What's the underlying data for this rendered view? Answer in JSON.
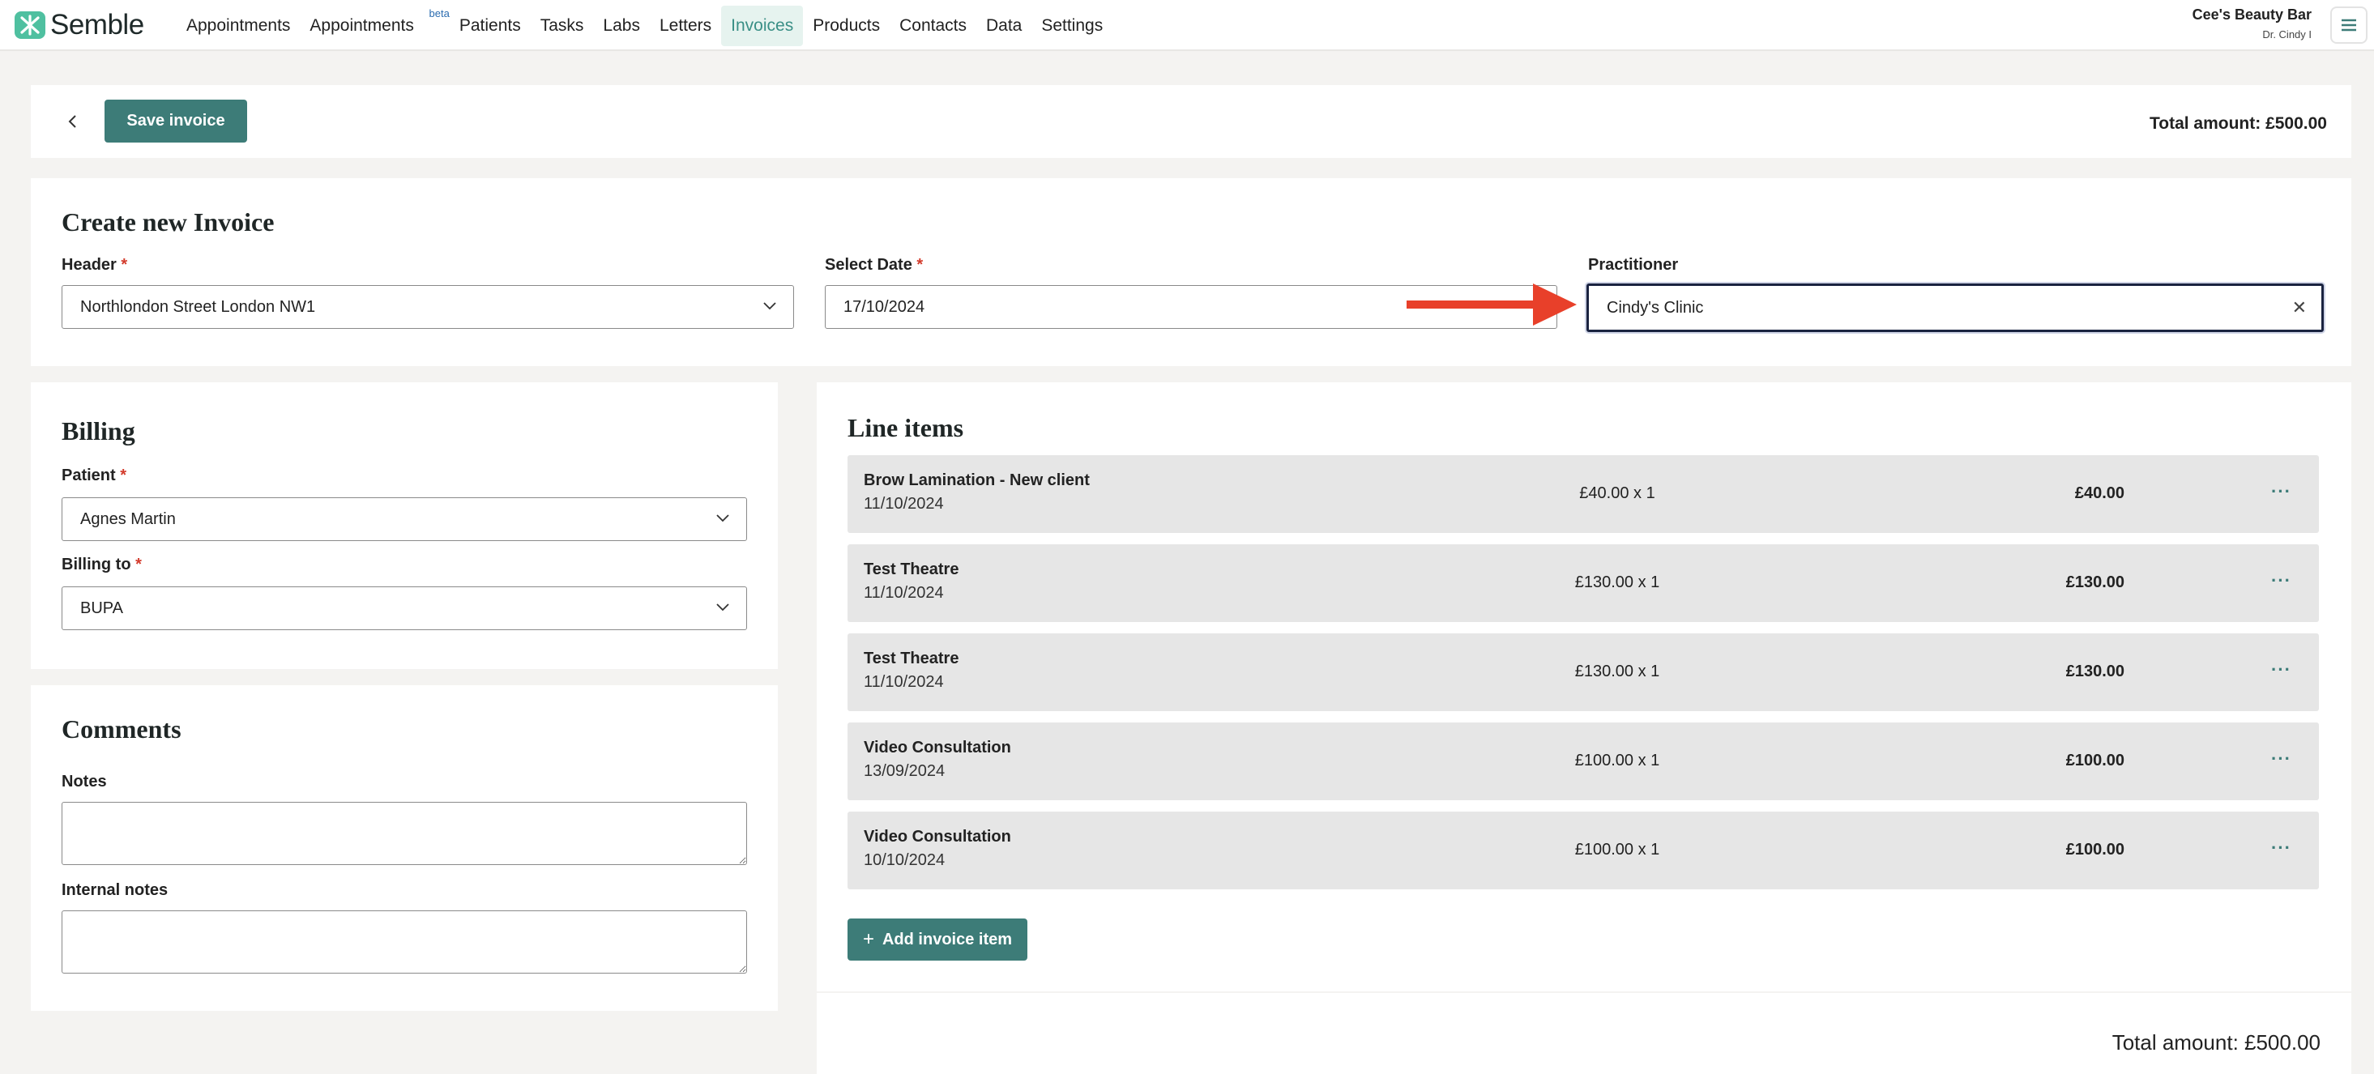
{
  "brand": {
    "name": "Semble"
  },
  "nav": {
    "items": [
      {
        "label": "Appointments"
      },
      {
        "label": "Appointments",
        "badge": "beta"
      },
      {
        "label": "Patients"
      },
      {
        "label": "Tasks"
      },
      {
        "label": "Labs"
      },
      {
        "label": "Letters"
      },
      {
        "label": "Invoices",
        "active": true
      },
      {
        "label": "Products"
      },
      {
        "label": "Contacts"
      },
      {
        "label": "Data"
      },
      {
        "label": "Settings"
      }
    ]
  },
  "account": {
    "company": "Cee's Beauty Bar",
    "user": "Dr. Cindy I"
  },
  "toolbar": {
    "save_label": "Save invoice",
    "total": "Total amount: £500.00"
  },
  "create": {
    "title": "Create new Invoice",
    "header_label": "Header",
    "header_value": "Northlondon Street London NW1",
    "date_label": "Select Date",
    "date_value": "17/10/2024",
    "practitioner_label": "Practitioner",
    "practitioner_value": "Cindy's Clinic"
  },
  "billing": {
    "title": "Billing",
    "patient_label": "Patient",
    "patient_value": "Agnes Martin",
    "billing_to_label": "Billing to",
    "billing_to_value": "BUPA"
  },
  "comments": {
    "title": "Comments",
    "notes_label": "Notes",
    "internal_notes_label": "Internal notes"
  },
  "line_items": {
    "title": "Line items",
    "items": [
      {
        "name": "Brow Lamination - New client",
        "date": "11/10/2024",
        "qty": "£40.00 x 1",
        "amount": "£40.00"
      },
      {
        "name": "Test Theatre",
        "date": "11/10/2024",
        "qty": "£130.00 x 1",
        "amount": "£130.00"
      },
      {
        "name": "Test Theatre",
        "date": "11/10/2024",
        "qty": "£130.00 x 1",
        "amount": "£130.00"
      },
      {
        "name": "Video Consultation",
        "date": "13/09/2024",
        "qty": "£100.00 x 1",
        "amount": "£100.00"
      },
      {
        "name": "Video Consultation",
        "date": "10/10/2024",
        "qty": "£100.00 x 1",
        "amount": "£100.00"
      }
    ],
    "more_glyph": "···",
    "add_label": "Add invoice item"
  },
  "footer": {
    "total": "Total amount: £500.00"
  },
  "colors": {
    "accent": "#3d7c78",
    "brand": "#4fc0a0",
    "required": "#d33b2c",
    "annotation_arrow": "#e8402a"
  }
}
